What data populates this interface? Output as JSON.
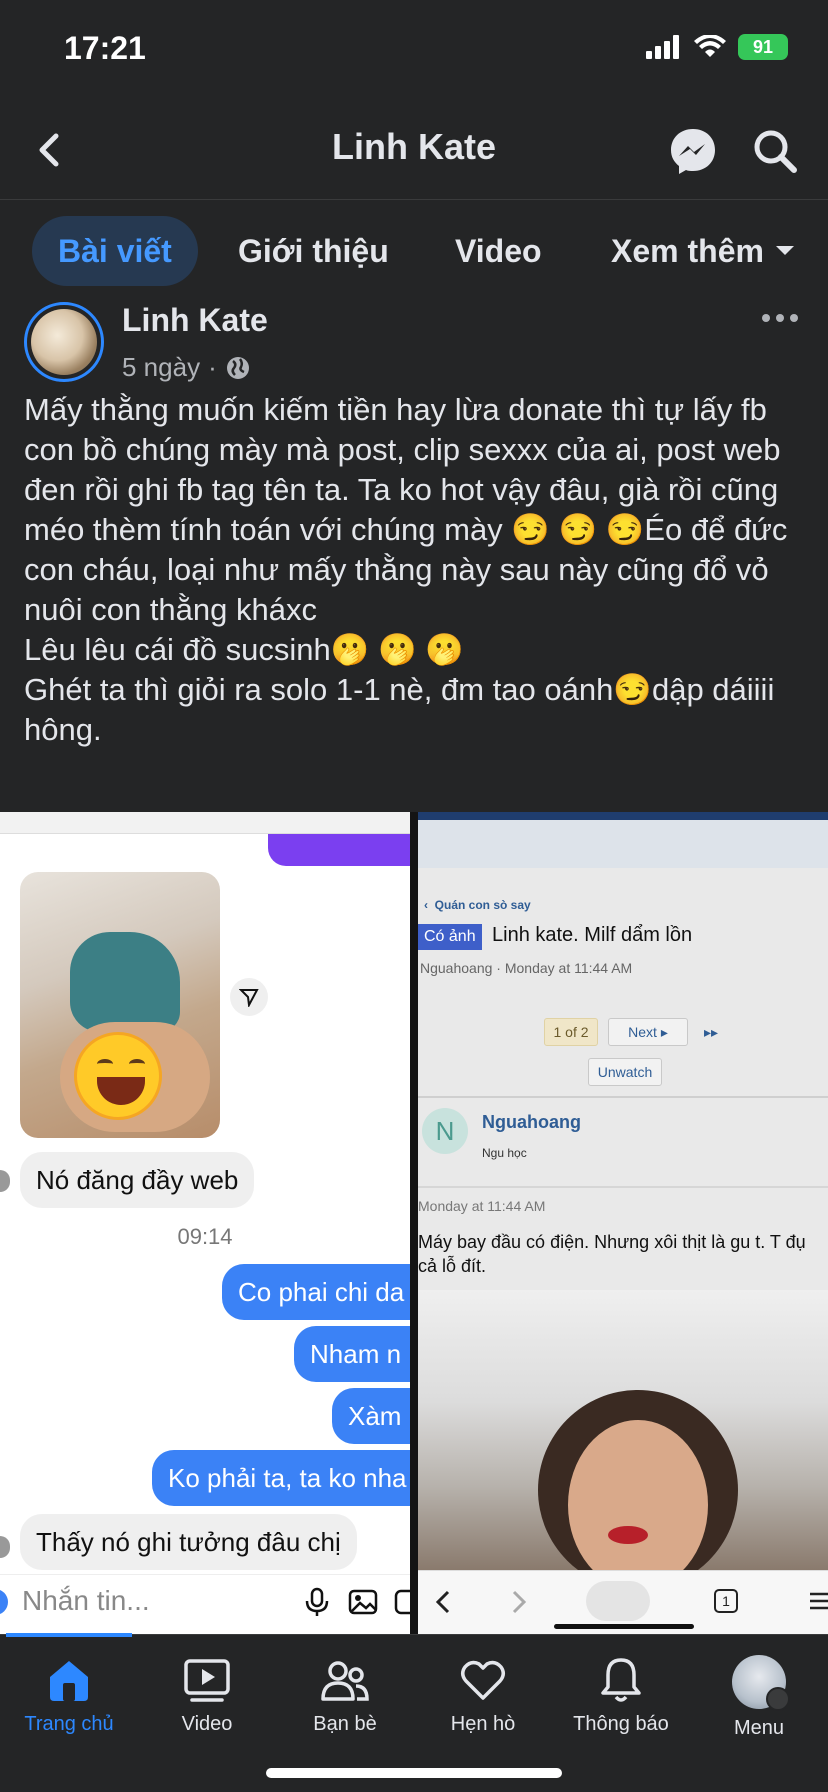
{
  "status_bar": {
    "time": "17:21",
    "battery": "91"
  },
  "header": {
    "title": "Linh Kate"
  },
  "tabs": [
    {
      "label": "Bài viết"
    },
    {
      "label": "Giới thiệu"
    },
    {
      "label": "Video"
    },
    {
      "label": "Xem thêm"
    }
  ],
  "post": {
    "author": "Linh Kate",
    "time": "5 ngày",
    "separator": "·",
    "lines": [
      "Mấy thằng muốn kiếm tiền hay lừa donate thì tự lấy fb con bồ chúng mày mà post, clip sexxx của ai, post web đen rồi ghi fb tag tên ta. Ta ko hot vậy đâu, già rồi cũng méo thèm tính toán với chúng mày 😏 😏 😏Éo để đức con cháu, loại như mấy thằng này sau này cũng đổ vỏ nuôi con thằng kháxc",
      "Lêu lêu cái đồ sucsinh🫢 🫢 🫢",
      "Ghét ta thì giỏi ra solo 1-1 nè, đm tao oánh😏dập dáiiii hông."
    ]
  },
  "left_chat": {
    "time_label": "09:14",
    "incoming_1": "Nó đăng đầy web",
    "outgoing": [
      "Co phai chi da",
      "Nham n",
      "Xàm",
      "Ko phải ta, ta ko nha"
    ],
    "incoming_2": "Thấy nó ghi tưởng đâu chị",
    "composer_placeholder": "Nhắn tin..."
  },
  "right_forum": {
    "breadcrumb": "Quán con sò say",
    "tag": "Có ảnh",
    "title": "Linh kate. Milf dẩm lồn",
    "byline": "Nguahoang · Monday at 11:44 AM",
    "pager": "1 of 2",
    "next": "Next",
    "unwatch": "Unwatch",
    "poster_initial": "N",
    "poster_name": "Nguahoang",
    "poster_rank": "Ngu học",
    "post_date": "Monday at 11:44 AM",
    "post_body": "Máy bay đầu có điện. Nhưng xôi thịt là gu t. T đụ cả lỗ đít.",
    "tab_count": "1"
  },
  "bottom_nav": [
    {
      "label": "Trang chủ",
      "icon": "home-icon",
      "active": true
    },
    {
      "label": "Video",
      "icon": "video-icon"
    },
    {
      "label": "Bạn bè",
      "icon": "friends-icon"
    },
    {
      "label": "Hẹn hò",
      "icon": "dating-icon"
    },
    {
      "label": "Thông báo",
      "icon": "bell-icon"
    },
    {
      "label": "Menu",
      "icon": "menu-avatar"
    }
  ],
  "colors": {
    "accent": "#2d88ff",
    "background": "#242526",
    "active_tab_bg": "#263951"
  }
}
